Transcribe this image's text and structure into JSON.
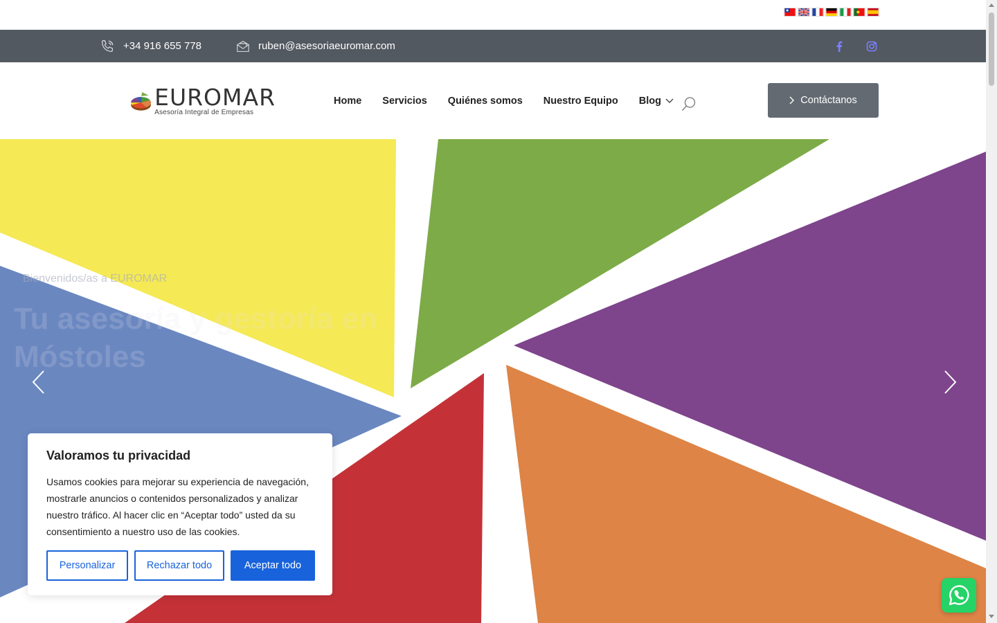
{
  "languages": [
    "zh-TW",
    "en",
    "fr",
    "de",
    "it",
    "pt",
    "es"
  ],
  "contact": {
    "phone": "+34 916 655 778",
    "email": "ruben@asesoriaeuromar.com"
  },
  "social": [
    "facebook-icon",
    "instagram-icon"
  ],
  "logo": {
    "name": "EUROMAR",
    "tagline": "Asesoría Integral de Empresas"
  },
  "nav": {
    "items": [
      "Home",
      "Servicios",
      "Quiénes somos",
      "Nuestro Equipo",
      "Blog"
    ],
    "cta": "Contáctanos"
  },
  "hero": {
    "subtitle": "Bienvenidos/as a EUROMAR",
    "title": "Tu asesoría y gestoría en Móstoles",
    "slides": 3
  },
  "cookie": {
    "title": "Valoramos tu privacidad",
    "text": "Usamos cookies para mejorar su experiencia de navegación, mostrarle anuncios o contenidos personalizados y analizar nuestro tráfico. Al hacer clic en “Aceptar todo” usted da su consentimiento a nuestro uso de las cookies.",
    "customize": "Personalizar",
    "reject": "Rechazar todo",
    "accept": "Aceptar todo"
  },
  "colors": {
    "topbar": "#535961",
    "accent": "#1863dc",
    "yellow": "#f5e955",
    "green": "#7dab48",
    "purple": "#7e448c",
    "blue": "#6a87c0",
    "red": "#c43238",
    "orange": "#dd8446",
    "whatsapp": "#25d366"
  }
}
